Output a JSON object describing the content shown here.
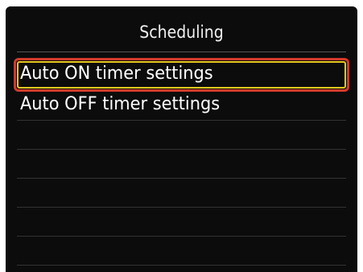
{
  "screen": {
    "title": "Scheduling"
  },
  "menu": {
    "items": [
      {
        "label": "Auto ON timer settings",
        "selected": true
      },
      {
        "label": "Auto OFF timer settings",
        "selected": false
      }
    ]
  },
  "colors": {
    "background": "#0c0c0c",
    "text": "#ffffff",
    "selection_outer": "#d23a2c",
    "selection_inner": "#e7c81e"
  }
}
